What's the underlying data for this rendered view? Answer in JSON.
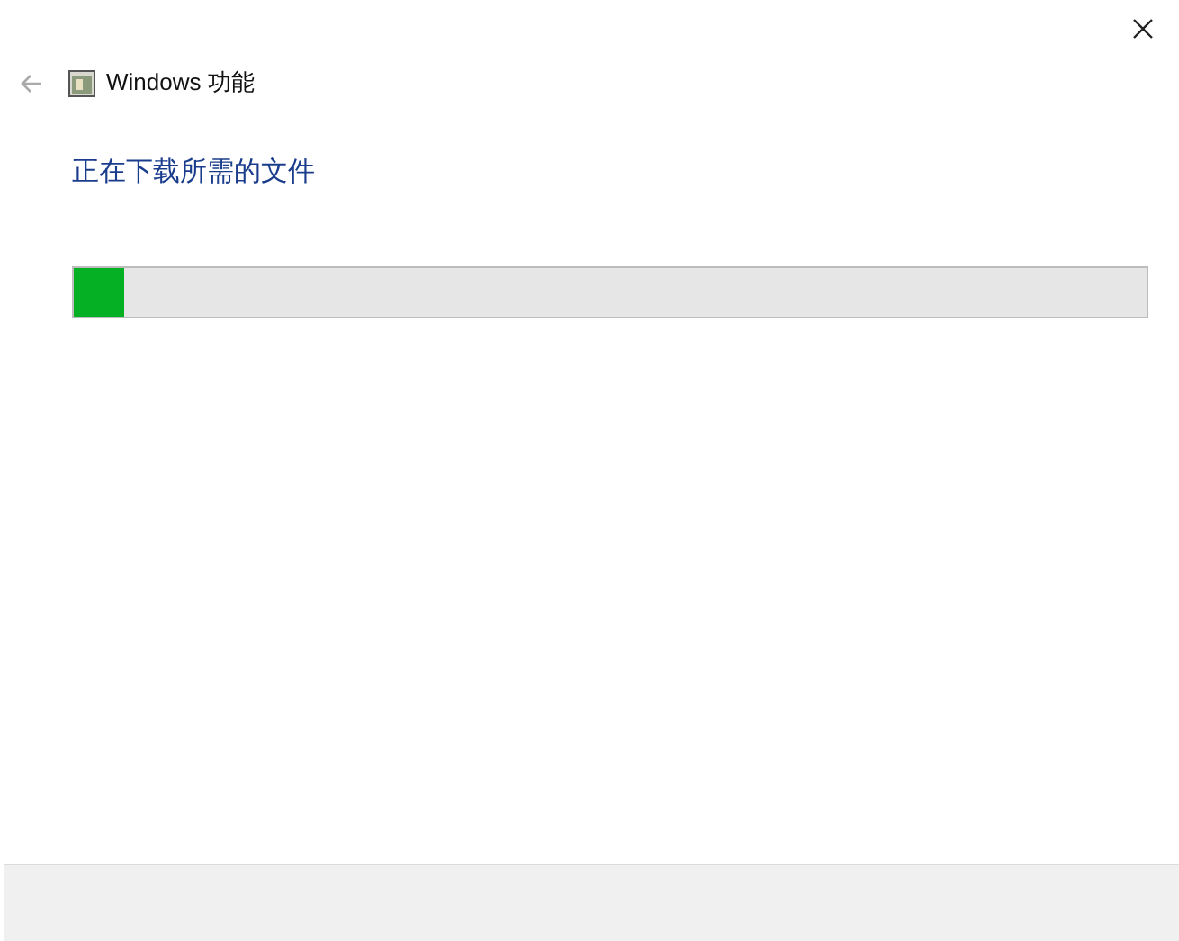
{
  "window": {
    "title": "Windows 功能"
  },
  "heading": "正在下载所需的文件",
  "progress": {
    "level": 0.047
  }
}
